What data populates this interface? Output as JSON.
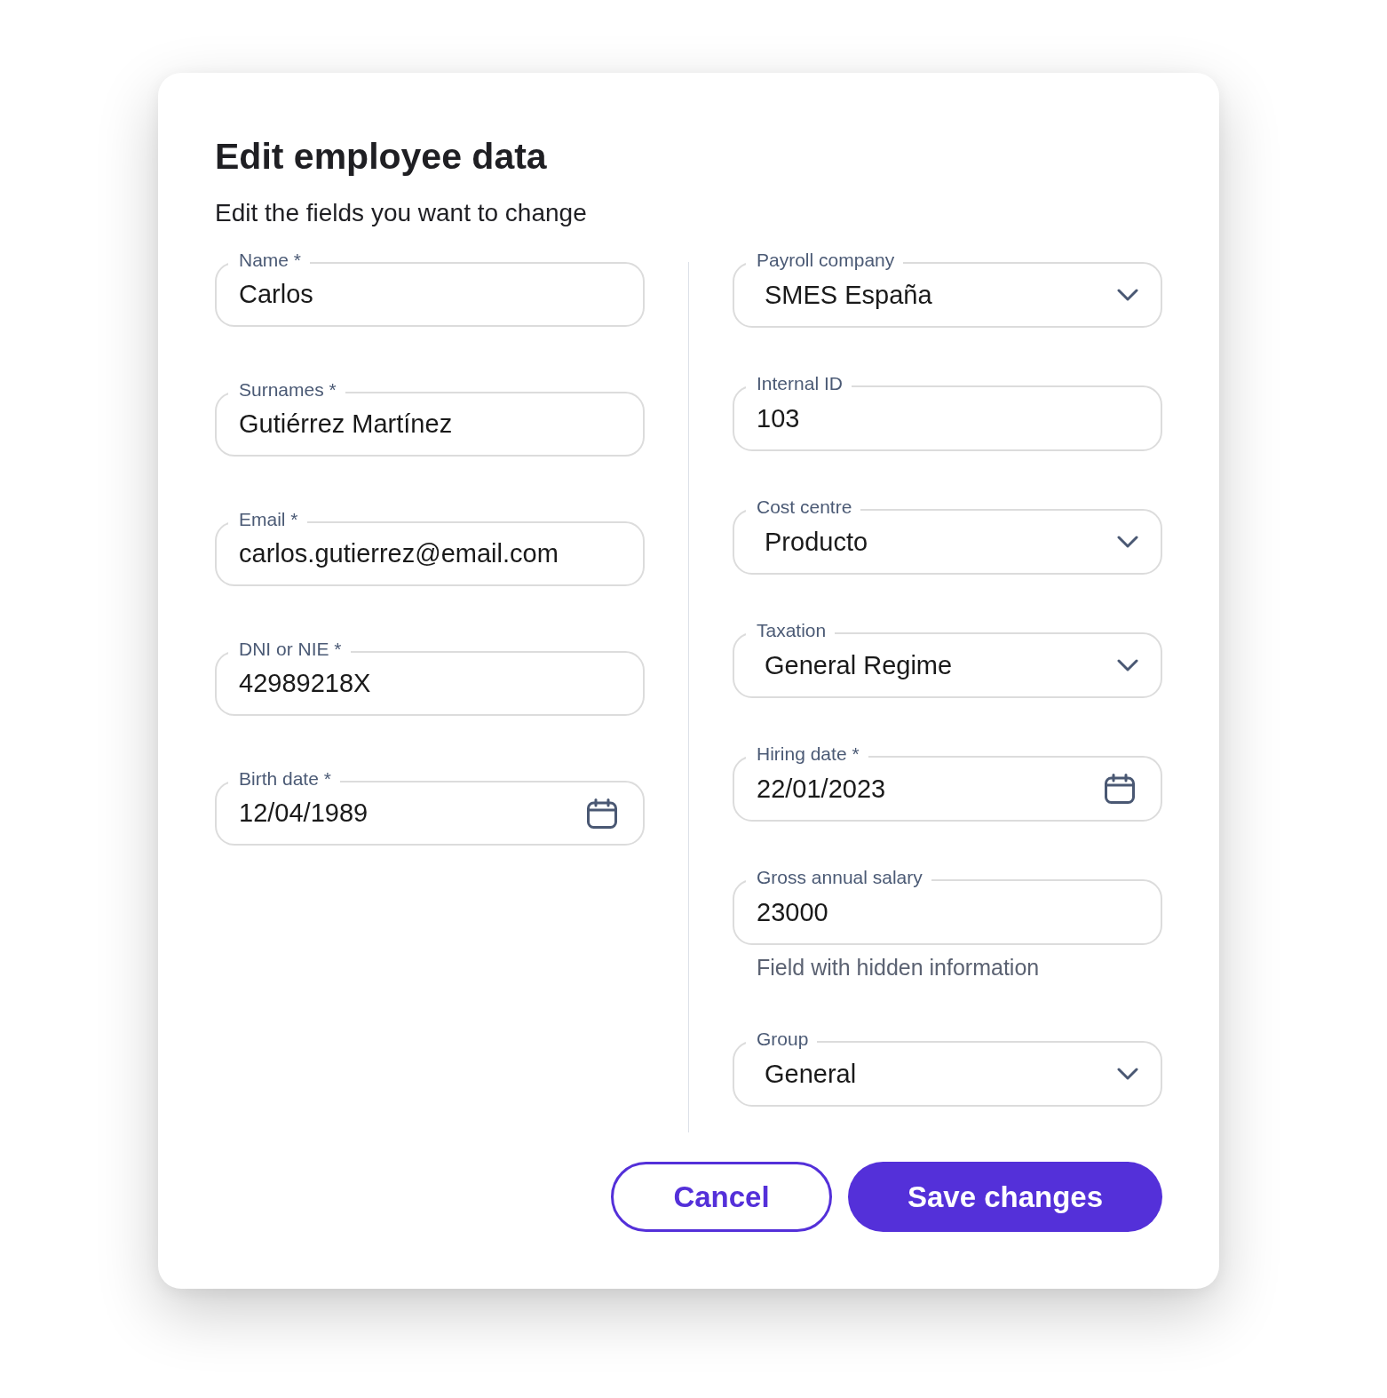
{
  "dialog": {
    "title": "Edit employee data",
    "subtitle": "Edit the fields you want to change"
  },
  "left_fields": [
    {
      "kind": "text",
      "label": "Name *",
      "value": "Carlos"
    },
    {
      "kind": "text",
      "label": "Surnames *",
      "value": "Gutiérrez Martínez"
    },
    {
      "kind": "text",
      "label": "Email *",
      "value": "carlos.gutierrez@email.com"
    },
    {
      "kind": "text",
      "label": "DNI or NIE *",
      "value": "42989218X"
    },
    {
      "kind": "date",
      "label": "Birth date *",
      "value": "12/04/1989"
    }
  ],
  "right_fields": [
    {
      "kind": "select",
      "label": "Payroll company",
      "value": "SMES España"
    },
    {
      "kind": "text",
      "label": "Internal ID",
      "value": "103"
    },
    {
      "kind": "select",
      "label": "Cost centre",
      "value": "Producto"
    },
    {
      "kind": "select",
      "label": "Taxation",
      "value": "General Regime"
    },
    {
      "kind": "date",
      "label": "Hiring date *",
      "value": "22/01/2023"
    },
    {
      "kind": "text",
      "label": "Gross annual salary",
      "value": "23000",
      "helper": "Field with hidden information"
    },
    {
      "kind": "select",
      "label": "Group",
      "value": "General"
    }
  ],
  "buttons": [
    {
      "kind": "secondary",
      "label": "Cancel"
    },
    {
      "kind": "primary",
      "label": "Save changes"
    }
  ]
}
